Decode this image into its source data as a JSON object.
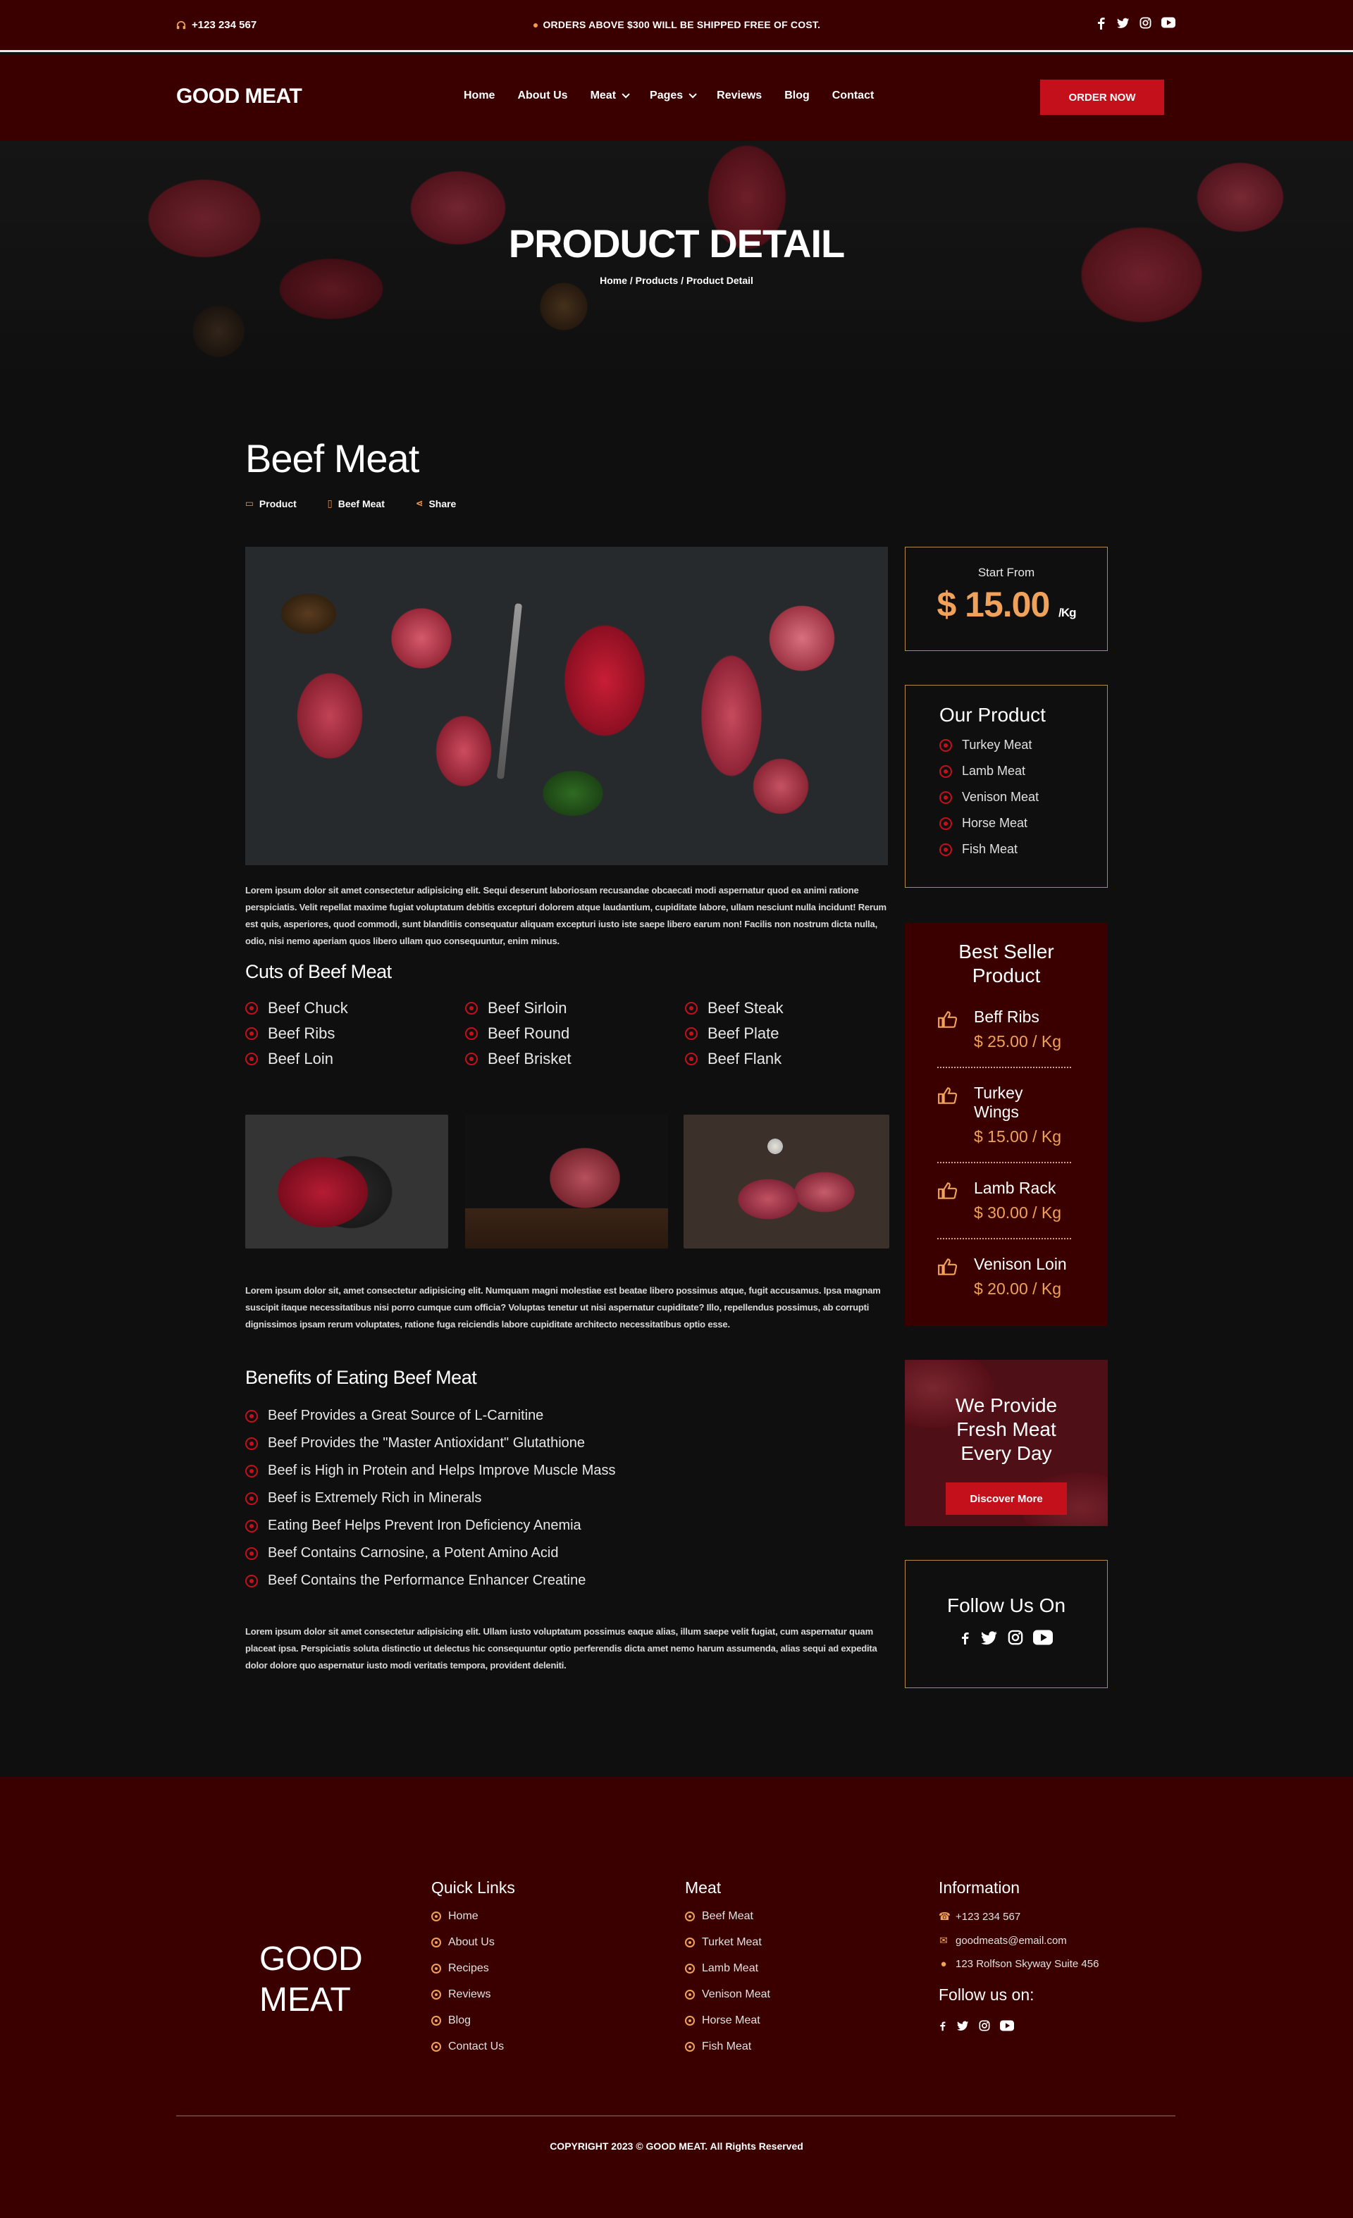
{
  "topbar": {
    "phone": "+123 234 567",
    "notice": "ORDERS ABOVE $300 WILL BE SHIPPED FREE OF COST."
  },
  "nav": {
    "logo": "GOOD MEAT",
    "items": [
      "Home",
      "About Us",
      "Meat",
      "Pages",
      "Reviews",
      "Blog",
      "Contact"
    ],
    "order_button": "ORDER NOW"
  },
  "hero": {
    "title": "PRODUCT DETAIL",
    "breadcrumb": "Home / Products / Product Detail"
  },
  "product": {
    "title": "Beef Meat",
    "meta": [
      "Product",
      "Beef Meat",
      "Share"
    ],
    "para1": "Lorem ipsum dolor sit amet consectetur adipisicing elit. Sequi deserunt laboriosam recusandae obcaecati modi aspernatur quod ea animi ratione perspiciatis. Velit repellat maxime fugiat voluptatum debitis excepturi dolorem atque laudantium, cupiditate labore, ullam nesciunt nulla incidunt! Rerum est quis, asperiores, quod commodi, sunt blanditiis consequatur aliquam excepturi iusto iste saepe libero earum non! Facilis non nostrum dicta nulla, odio, nisi nemo aperiam quos libero ullam quo consequuntur, enim minus.",
    "cuts_title": "Cuts of Beef Meat",
    "cuts": [
      "Beef Chuck",
      "Beef Sirloin",
      "Beef Steak",
      "Beef Ribs",
      "Beef Round",
      "Beef Plate",
      "Beef Loin",
      "Beef Brisket",
      "Beef Flank"
    ],
    "para2": "Lorem ipsum dolor sit, amet consectetur adipisicing elit. Numquam magni molestiae est beatae libero possimus atque, fugit accusamus. Ipsa magnam suscipit itaque necessitatibus nisi porro cumque cum officia? Voluptas tenetur ut nisi aspernatur cupiditate? Illo, repellendus possimus, ab corrupti dignissimos ipsam rerum voluptates, ratione fuga reiciendis labore cupiditate architecto necessitatibus optio esse.",
    "benefits_title": "Benefits of Eating Beef Meat",
    "benefits": [
      "Beef Provides a Great Source of L-Carnitine",
      "Beef Provides the \"Master Antioxidant\" Glutathione",
      "Beef is High in Protein and Helps Improve Muscle Mass",
      "Beef is Extremely Rich in Minerals",
      "Eating Beef Helps Prevent Iron Deficiency Anemia",
      "Beef Contains Carnosine, a Potent Amino Acid",
      "Beef Contains the Performance Enhancer Creatine"
    ],
    "para3": "Lorem ipsum dolor sit amet consectetur adipisicing elit. Ullam iusto voluptatum possimus eaque alias, illum saepe velit fugiat, cum aspernatur quam placeat ipsa. Perspiciatis soluta distinctio ut delectus hic consequuntur optio perferendis dicta amet nemo harum assumenda, alias sequi ad expedita dolor dolore quo aspernatur iusto modi veritatis tempora, provident deleniti."
  },
  "sidebar": {
    "price_label": "Start From",
    "price": "$ 15.00",
    "price_unit": "/Kg",
    "our_product_title": "Our Product",
    "our_products": [
      "Turkey Meat",
      "Lamb Meat",
      "Venison Meat",
      "Horse Meat",
      "Fish Meat"
    ],
    "best_title": "Best Seller Product",
    "best": [
      {
        "name": "Beff Ribs",
        "price": "$ 25.00 / Kg"
      },
      {
        "name": "Turkey Wings",
        "price": "$ 15.00 / Kg"
      },
      {
        "name": "Lamb Rack",
        "price": "$ 30.00 / Kg"
      },
      {
        "name": "Venison Loin",
        "price": "$ 20.00 / Kg"
      }
    ],
    "promo_title": "We Provide Fresh Meat Every Day",
    "promo_button": "Discover More",
    "follow_title": "Follow Us On"
  },
  "footer": {
    "logo": "GOOD MEAT",
    "quick_title": "Quick Links",
    "quick": [
      "Home",
      "About Us",
      "Recipes",
      "Reviews",
      "Blog",
      "Contact Us"
    ],
    "meat_title": "Meat",
    "meat": [
      "Beef Meat",
      "Turket Meat",
      "Lamb Meat",
      "Venison Meat",
      "Horse Meat",
      "Fish Meat"
    ],
    "info_title": "Information",
    "phone": "+123 234 567",
    "email": "goodmeats@email.com",
    "address": "123 Rolfson Skyway Suite 456",
    "follow": "Follow us on:",
    "copyright": "COPYRIGHT 2023 © GOOD MEAT. All Rights Reserved"
  },
  "colors": {
    "maroon": "#3a0000",
    "accent_red": "#c4101b",
    "accent_orange": "#f0a15a",
    "body_bg": "#0f0f0f"
  }
}
